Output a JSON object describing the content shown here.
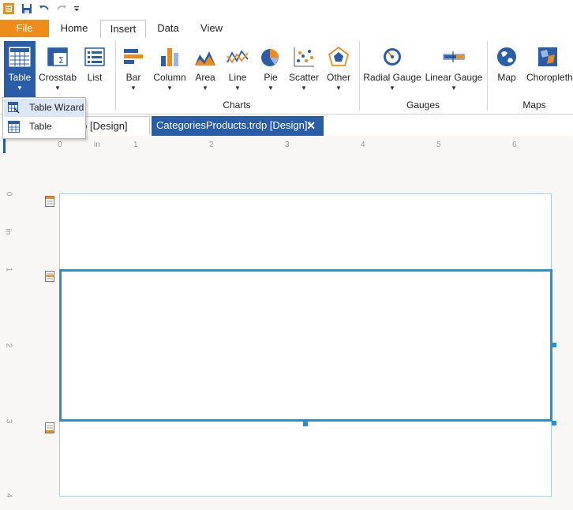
{
  "quick_access": {
    "icons": [
      "app-icon",
      "save-icon",
      "undo-icon",
      "redo-icon",
      "customize-arrow-icon"
    ]
  },
  "ribbon_tabs": {
    "file": "File",
    "home": "Home",
    "insert": "Insert",
    "data": "Data",
    "view": "View",
    "active": "Insert"
  },
  "ribbon": {
    "table": "Table",
    "crosstab": "Crosstab",
    "list": "List",
    "bar": "Bar",
    "column": "Column",
    "area": "Area",
    "line": "Line",
    "pie": "Pie",
    "scatter": "Scatter",
    "other": "Other",
    "radial_gauge": "Radial Gauge",
    "linear_gauge": "Linear Gauge",
    "map": "Map",
    "choropleth": "Choropleth",
    "groups": {
      "charts": "Charts",
      "gauges": "Gauges",
      "maps": "Maps"
    }
  },
  "table_menu": {
    "items": [
      "Table Wizard",
      "Table"
    ],
    "highlighted": "Table Wizard"
  },
  "documents": {
    "tab1": "p [Design]",
    "tab2": "CategoriesProducts.trdp [Design]*",
    "close": "✕"
  },
  "ruler": {
    "h_numbers": [
      "0",
      "1",
      "2",
      "3",
      "4",
      "5",
      "6"
    ],
    "h_unit": "in",
    "v_numbers": [
      "0",
      "1",
      "2",
      "3",
      "4"
    ],
    "v_unit": "in"
  },
  "colors": {
    "accent": "#2a5da8",
    "file_tab": "#ee8c1a",
    "selection": "#2b8fce"
  }
}
